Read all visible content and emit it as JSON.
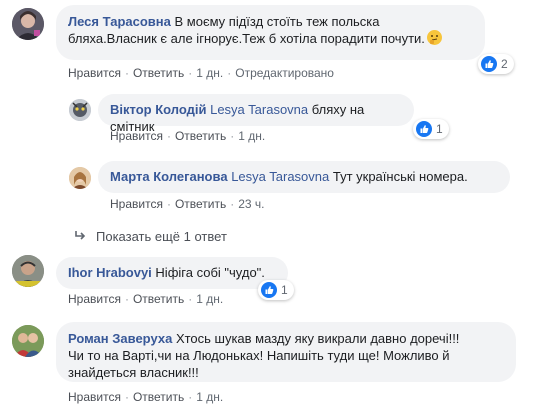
{
  "colors": {
    "author": "#385898",
    "bubble": "#f2f3f5",
    "like_blue": "#1877f2",
    "action_text": "#606770"
  },
  "comments": [
    {
      "author": "Леся Тарасовна",
      "text_line1": "В моєму підїзд стоїть теж польска",
      "text_line2": "бляха.Власник є але ігнорує.Теж б хотіла порадити почути.",
      "emoji_icon": "thinking-face-icon",
      "like": "Нравится",
      "reply": "Ответить",
      "time": "1 дн.",
      "edited": "Отредактировано",
      "reactions": "2"
    },
    {
      "author": "Віктор Колодій",
      "mention": "Lesya Tarasovna",
      "text": "бляху на смітник",
      "like": "Нравится",
      "reply": "Ответить",
      "time": "1 дн.",
      "reactions": "1"
    },
    {
      "author": "Марта Колеганова",
      "mention": "Lesya Tarasovna",
      "text": "Тут українські номера.",
      "like": "Нравится",
      "reply": "Ответить",
      "time": "23 ч."
    },
    {
      "author": "Ihor Hrabovyi",
      "text": "Ніфіга собі \"чудо\".",
      "like": "Нравится",
      "reply": "Ответить",
      "time": "1 дн.",
      "reactions": "1"
    },
    {
      "author": "Роман Заверуха",
      "text_line1": "Хтось шукав мазду яку викрали давно доречі!!!",
      "text_line2": "Чи то на Варті,чи на Людоньках! Напишіть туди ще! Можливо й",
      "text_line3": "знайдеться власник!!!",
      "like": "Нравится",
      "reply": "Ответить",
      "time": "1 дн."
    }
  ],
  "more_replies": {
    "label": "Показать ещё 1 ответ",
    "icon": "reply-arrow-icon"
  }
}
